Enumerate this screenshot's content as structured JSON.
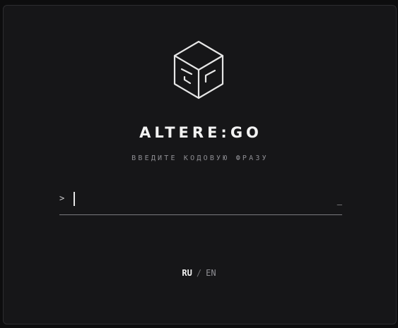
{
  "logo": {
    "icon": "cube-icon",
    "stroke_color": "#e6e6e6"
  },
  "brand": {
    "title": "ALTERE:GO"
  },
  "subtitle": "ВВЕДИТЕ КОДОВУЮ ФРАЗУ",
  "code_input": {
    "prompt": ">",
    "value": "",
    "placeholder": "",
    "end_marker": "_"
  },
  "language": {
    "active": "RU",
    "separator": "/",
    "inactive": "EN"
  },
  "colors": {
    "background": "#161618",
    "accent": "#f2f2f2",
    "muted": "#8e8e93"
  }
}
